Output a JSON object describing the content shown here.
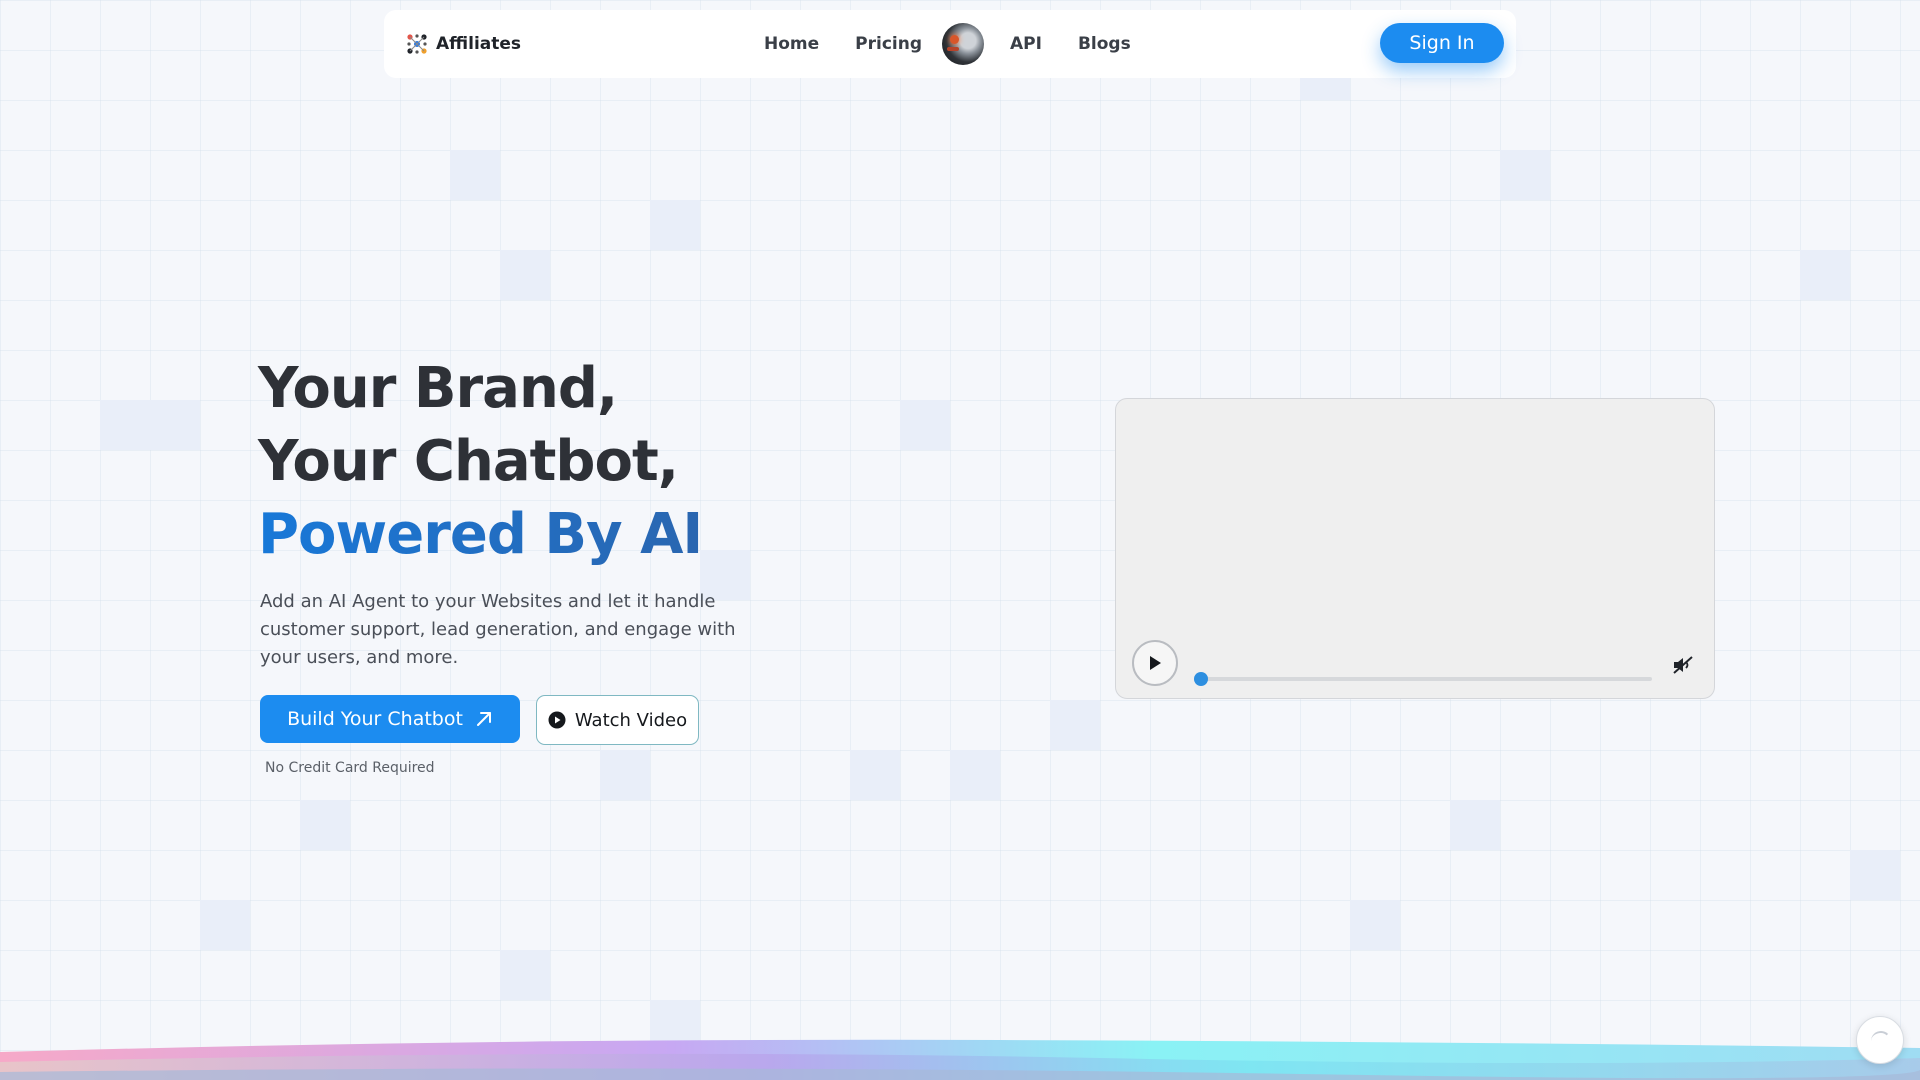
{
  "nav": {
    "brand": "Affiliates",
    "links": [
      "Home",
      "Pricing",
      "API",
      "Blogs"
    ],
    "signin_label": "Sign In"
  },
  "hero": {
    "title_line1": "Your Brand,",
    "title_line2": "Your Chatbot,",
    "title_line3": "Powered By AI",
    "description": "Add an AI Agent to your Websites and let it handle customer support, lead generation, and engage with your users, and more.",
    "build_button": "Build Your Chatbot",
    "watch_button": "Watch Video",
    "note": "No Credit Card Required"
  },
  "video": {
    "progress": 0
  },
  "colors": {
    "primary": "#1c8cf0",
    "accent_text": "#1878d8"
  },
  "icons": [
    "brand-logo-icon",
    "play-icon",
    "mute-icon",
    "arrow-up-right-icon",
    "play-circle-icon",
    "chat-widget-icon"
  ]
}
